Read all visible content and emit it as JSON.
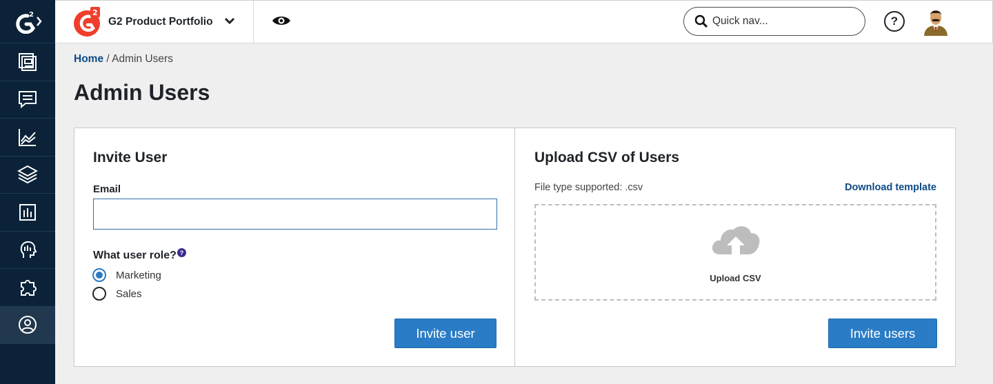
{
  "header": {
    "product_name": "G2 Product Portfolio",
    "search_placeholder": "Quick nav..."
  },
  "breadcrumb": {
    "home": "Home",
    "separator": "/",
    "current": "Admin Users"
  },
  "page": {
    "title": "Admin Users"
  },
  "invite": {
    "title": "Invite User",
    "email_label": "Email",
    "email_value": "",
    "role_label": "What user role?",
    "role_help": "?",
    "roles": [
      {
        "label": "Marketing",
        "selected": true
      },
      {
        "label": "Sales",
        "selected": false
      }
    ],
    "button": "Invite user"
  },
  "upload": {
    "title": "Upload CSV of Users",
    "file_type": "File type supported: .csv",
    "download_link": "Download template",
    "dropzone_label": "Upload CSV",
    "button": "Invite users"
  },
  "sidebar": {
    "items": [
      {
        "icon": "product-profile-icon",
        "active": false
      },
      {
        "icon": "reviews-icon",
        "active": false
      },
      {
        "icon": "reports-icon",
        "active": false
      },
      {
        "icon": "layers-icon",
        "active": false
      },
      {
        "icon": "content-icon",
        "active": false
      },
      {
        "icon": "buyer-intent-icon",
        "active": false
      },
      {
        "icon": "integrations-icon",
        "active": false
      },
      {
        "icon": "user-admin-icon",
        "active": true
      }
    ]
  },
  "colors": {
    "rail": "#0b2238",
    "brand_red": "#ef3e2c",
    "primary_button": "#2a7cc6",
    "link": "#0d4a86"
  }
}
